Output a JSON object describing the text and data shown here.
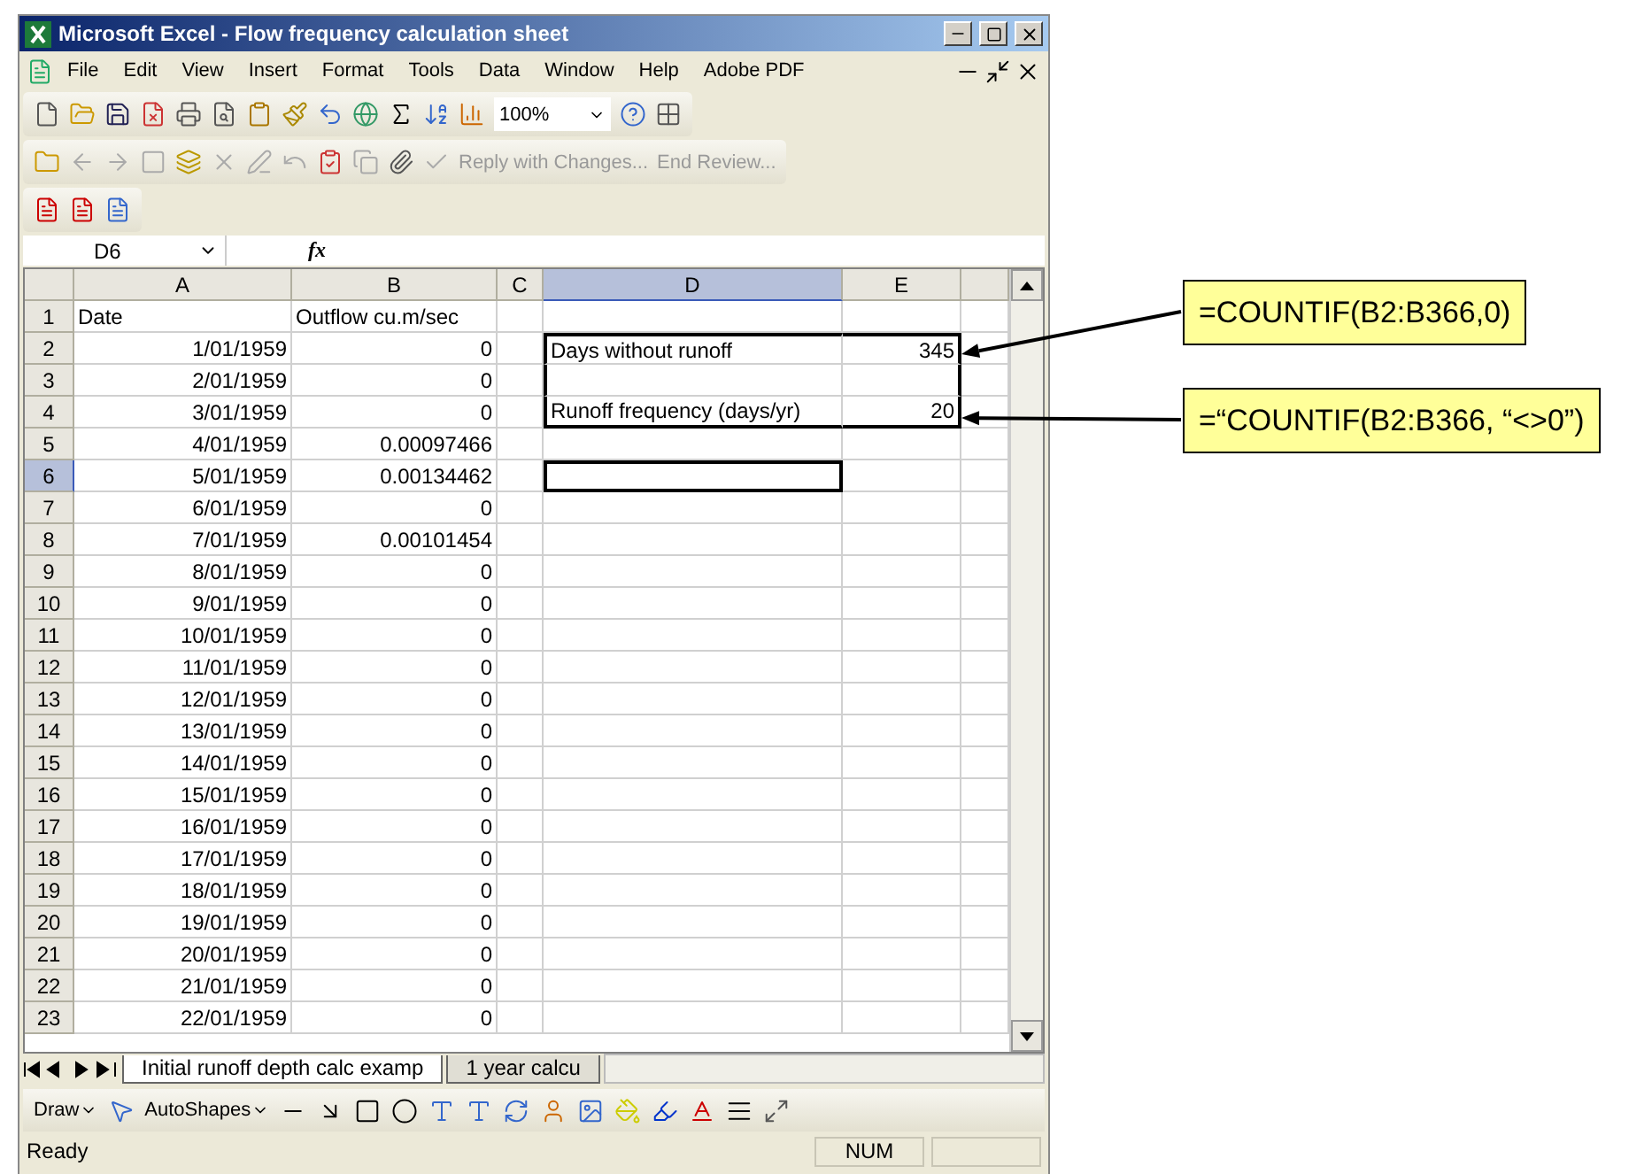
{
  "window": {
    "title": "Microsoft Excel - Flow frequency calculation sheet"
  },
  "menu": [
    "File",
    "Edit",
    "View",
    "Insert",
    "Format",
    "Tools",
    "Data",
    "Window",
    "Help",
    "Adobe PDF"
  ],
  "zoom": "100%",
  "review_toolbar": [
    "Reply with Changes...",
    "End Review..."
  ],
  "name_box": "D6",
  "formula_label": "fx",
  "columns": [
    {
      "label": "A",
      "selected": false
    },
    {
      "label": "B",
      "selected": false
    },
    {
      "label": "C",
      "selected": false
    },
    {
      "label": "D",
      "selected": true
    },
    {
      "label": "E",
      "selected": false
    }
  ],
  "rows": [
    {
      "header": "1",
      "kind": "heading",
      "selected": false,
      "boxed": false,
      "a": "Date",
      "b": "Outflow cu.m/sec"
    },
    {
      "header": "2",
      "kind": "data",
      "selected": false,
      "boxed": true,
      "a": "1/01/1959",
      "b": "0",
      "d": "Days without runoff",
      "e": "345"
    },
    {
      "header": "3",
      "kind": "data",
      "selected": false,
      "boxed": true,
      "a": "2/01/1959",
      "b": "0"
    },
    {
      "header": "4",
      "kind": "data",
      "selected": false,
      "boxed": true,
      "a": "3/01/1959",
      "b": "0",
      "d": "Runoff frequency (days/yr)",
      "e": "20"
    },
    {
      "header": "5",
      "kind": "data",
      "selected": false,
      "boxed": false,
      "a": "4/01/1959",
      "b": "0.00097466"
    },
    {
      "header": "6",
      "kind": "data",
      "selected": true,
      "boxed": false,
      "a": "5/01/1959",
      "b": "0.00134462"
    },
    {
      "header": "7",
      "kind": "data",
      "selected": false,
      "boxed": false,
      "a": "6/01/1959",
      "b": "0"
    },
    {
      "header": "8",
      "kind": "data",
      "selected": false,
      "boxed": false,
      "a": "7/01/1959",
      "b": "0.00101454"
    },
    {
      "header": "9",
      "kind": "data",
      "selected": false,
      "boxed": false,
      "a": "8/01/1959",
      "b": "0"
    },
    {
      "header": "10",
      "kind": "data",
      "selected": false,
      "boxed": false,
      "a": "9/01/1959",
      "b": "0"
    },
    {
      "header": "11",
      "kind": "data",
      "selected": false,
      "boxed": false,
      "a": "10/01/1959",
      "b": "0"
    },
    {
      "header": "12",
      "kind": "data",
      "selected": false,
      "boxed": false,
      "a": "11/01/1959",
      "b": "0"
    },
    {
      "header": "13",
      "kind": "data",
      "selected": false,
      "boxed": false,
      "a": "12/01/1959",
      "b": "0"
    },
    {
      "header": "14",
      "kind": "data",
      "selected": false,
      "boxed": false,
      "a": "13/01/1959",
      "b": "0"
    },
    {
      "header": "15",
      "kind": "data",
      "selected": false,
      "boxed": false,
      "a": "14/01/1959",
      "b": "0"
    },
    {
      "header": "16",
      "kind": "data",
      "selected": false,
      "boxed": false,
      "a": "15/01/1959",
      "b": "0"
    },
    {
      "header": "17",
      "kind": "data",
      "selected": false,
      "boxed": false,
      "a": "16/01/1959",
      "b": "0"
    },
    {
      "header": "18",
      "kind": "data",
      "selected": false,
      "boxed": false,
      "a": "17/01/1959",
      "b": "0"
    },
    {
      "header": "19",
      "kind": "data",
      "selected": false,
      "boxed": false,
      "a": "18/01/1959",
      "b": "0"
    },
    {
      "header": "20",
      "kind": "data",
      "selected": false,
      "boxed": false,
      "a": "19/01/1959",
      "b": "0"
    },
    {
      "header": "21",
      "kind": "data",
      "selected": false,
      "boxed": false,
      "a": "20/01/1959",
      "b": "0"
    },
    {
      "header": "22",
      "kind": "data",
      "selected": false,
      "boxed": false,
      "a": "21/01/1959",
      "b": "0"
    },
    {
      "header": "23",
      "kind": "data",
      "selected": false,
      "boxed": false,
      "a": "22/01/1959",
      "b": "0"
    }
  ],
  "sheet_tabs": [
    {
      "label": "Initial runoff depth calc examp",
      "selected": true
    },
    {
      "label": "1 year calcu",
      "selected": false
    }
  ],
  "drawing_toolbar": {
    "draw": "Draw",
    "autoshapes": "AutoShapes"
  },
  "status_bar": {
    "text": "Ready",
    "num": "NUM"
  },
  "callouts": [
    {
      "text": "=COUNTIF(B2:B366,0)"
    },
    {
      "text": "=“COUNTIF(B2:B366, “<>0”)"
    }
  ]
}
